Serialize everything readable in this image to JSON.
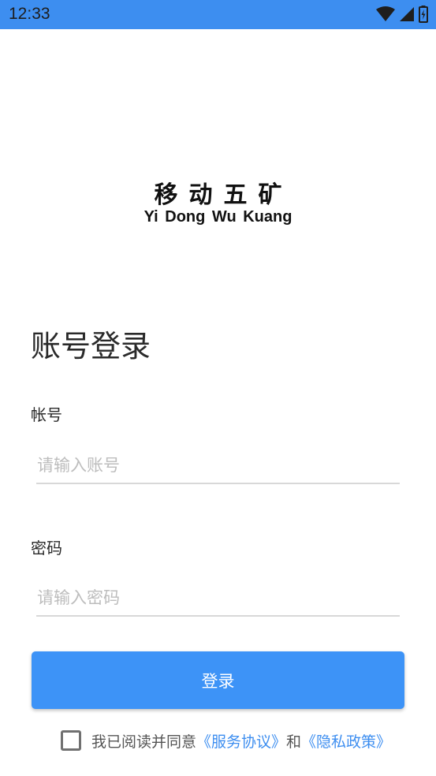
{
  "status_bar": {
    "time": "12:33",
    "icons": [
      "wifi-icon",
      "signal-icon",
      "battery-charging-icon"
    ],
    "background": "#3d8ef0"
  },
  "logo": {
    "title": "移动五矿",
    "subtitle": "Yi Dong Wu Kuang"
  },
  "page_title": "账号登录",
  "account": {
    "label": "帐号",
    "placeholder": "请输入账号",
    "value": ""
  },
  "password": {
    "label": "密码",
    "placeholder": "请输入密码",
    "value": ""
  },
  "login_button": {
    "label": "登录",
    "color": "#3d93f7"
  },
  "agreement": {
    "checked": false,
    "prefix": "我已阅读并同意",
    "service_link": "《服务协议》",
    "conjunction": "和",
    "privacy_link": "《隐私政策》",
    "link_color": "#3d8ef0"
  }
}
